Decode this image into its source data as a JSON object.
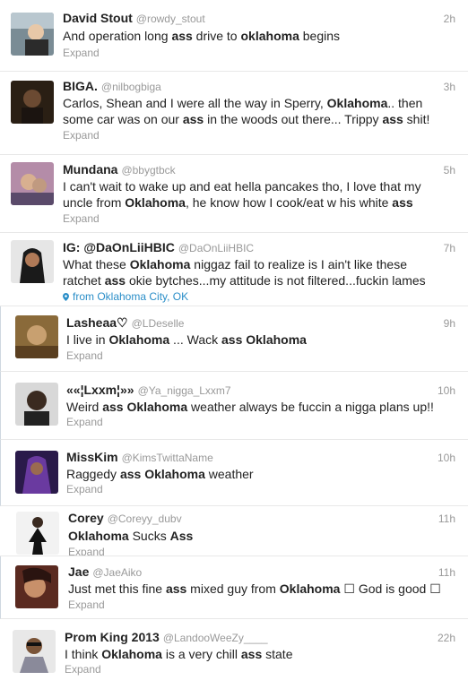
{
  "tweets": [
    {
      "name": "David Stout",
      "handle": "@rowdy_stout",
      "time": "2h",
      "segments": [
        [
          "And operation long ",
          0
        ],
        [
          "ass",
          1
        ],
        [
          " drive to ",
          0
        ],
        [
          "oklahoma",
          1
        ],
        [
          " begins",
          0
        ]
      ],
      "expand": "Expand"
    },
    {
      "name": "BIGA.",
      "handle": "@nilbogbiga",
      "time": "3h",
      "segments": [
        [
          "Carlos, Shean and I were all the way in Sperry, ",
          0
        ],
        [
          "Oklahoma",
          1
        ],
        [
          ".. then some car was on our ",
          0
        ],
        [
          "ass",
          1
        ],
        [
          " in the woods out there... Trippy ",
          0
        ],
        [
          "ass",
          1
        ],
        [
          " shit!",
          0
        ]
      ],
      "expand": "Expand"
    },
    {
      "name": "Mundana",
      "handle": "@bbygtbck",
      "time": "5h",
      "segments": [
        [
          "I can't wait to wake up and eat hella pancakes tho, I love that my uncle from ",
          0
        ],
        [
          "Oklahoma",
          1
        ],
        [
          ", he know how I cook/eat w his white ",
          0
        ],
        [
          "ass",
          1
        ]
      ],
      "expand": "Expand"
    },
    {
      "name": "IG: @DaOnLiiHBIC",
      "handle": "@DaOnLiiHBIC",
      "time": "7h",
      "segments": [
        [
          "What these ",
          0
        ],
        [
          "Oklahoma",
          1
        ],
        [
          " niggaz fail to realize is I ain't like these ratchet ",
          0
        ],
        [
          "ass",
          1
        ],
        [
          " okie bytches...my attitude is not filtered...fuckin lames",
          0
        ]
      ],
      "location": "from Oklahoma City, OK"
    },
    {
      "name": "Lasheaa♡",
      "handle": "@LDeselle",
      "time": "9h",
      "segments": [
        [
          "I live in ",
          0
        ],
        [
          "Oklahoma",
          1
        ],
        [
          " ... Wack ",
          0
        ],
        [
          "ass",
          1
        ],
        [
          " ",
          0
        ],
        [
          "Oklahoma",
          1
        ]
      ],
      "expand": "Expand"
    },
    {
      "name": "««¦Lxxm¦»»",
      "handle": "@Ya_nigga_Lxxm7",
      "time": "10h",
      "segments": [
        [
          "Weird ",
          0
        ],
        [
          "ass",
          1
        ],
        [
          " ",
          0
        ],
        [
          "Oklahoma",
          1
        ],
        [
          " weather always be fuccin a nigga plans up!!",
          0
        ]
      ],
      "expand": "Expand"
    },
    {
      "name": "MissKim",
      "handle": "@KimsTwittaName",
      "time": "10h",
      "segments": [
        [
          "Raggedy ",
          0
        ],
        [
          "ass",
          1
        ],
        [
          " ",
          0
        ],
        [
          "Oklahoma",
          1
        ],
        [
          " weather",
          0
        ]
      ],
      "expand": "Expand"
    },
    {
      "name": "Corey",
      "handle": "@Coreyy_dubv",
      "time": "11h",
      "segments": [
        [
          "Oklahoma",
          1
        ],
        [
          " Sucks ",
          0
        ],
        [
          "Ass",
          1
        ]
      ],
      "expand": "Expand"
    },
    {
      "name": "Jae",
      "handle": "@JaeAiko",
      "time": "11h",
      "segments": [
        [
          "Just met this fine ",
          0
        ],
        [
          "ass",
          1
        ],
        [
          " mixed guy from ",
          0
        ],
        [
          "Oklahoma",
          1
        ],
        [
          " ☐ God is good ☐",
          0
        ]
      ],
      "expand": "Expand"
    },
    {
      "name": "Prom King 2013",
      "handle": "@LandooWeeZy____",
      "time": "22h",
      "segments": [
        [
          "I think ",
          0
        ],
        [
          "Oklahoma",
          1
        ],
        [
          " is a very chill ",
          0
        ],
        [
          "ass",
          1
        ],
        [
          " state",
          0
        ]
      ],
      "expand": "Expand"
    }
  ],
  "colors": {
    "name": "#222222",
    "meta": "#999999",
    "link": "#2a8ec8",
    "border": "#e8e8e8"
  }
}
